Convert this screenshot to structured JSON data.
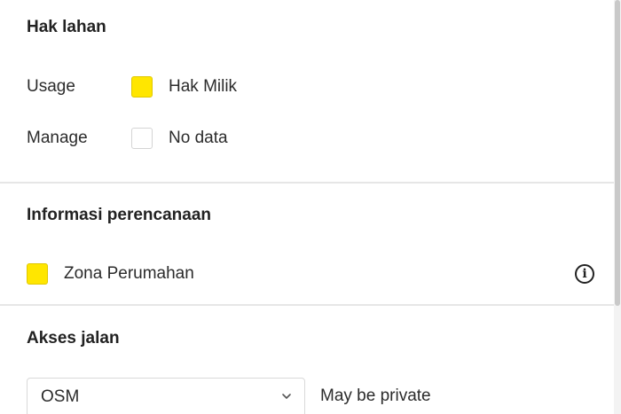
{
  "land_rights": {
    "title": "Hak lahan",
    "rows": [
      {
        "label": "Usage",
        "swatch": "yellow",
        "value": "Hak Milik"
      },
      {
        "label": "Manage",
        "swatch": "empty",
        "value": "No data"
      }
    ]
  },
  "planning": {
    "title": "Informasi perencanaan",
    "zone": {
      "swatch": "yellow",
      "label": "Zona Perumahan"
    },
    "info_icon": "info-circle-icon"
  },
  "road_access": {
    "title": "Akses jalan",
    "source_select": {
      "selected": "OSM",
      "icon": "chevron-down-icon"
    },
    "status": "May be private"
  },
  "colors": {
    "swatch_yellow": "#ffe600",
    "divider": "#e6e6e6"
  }
}
